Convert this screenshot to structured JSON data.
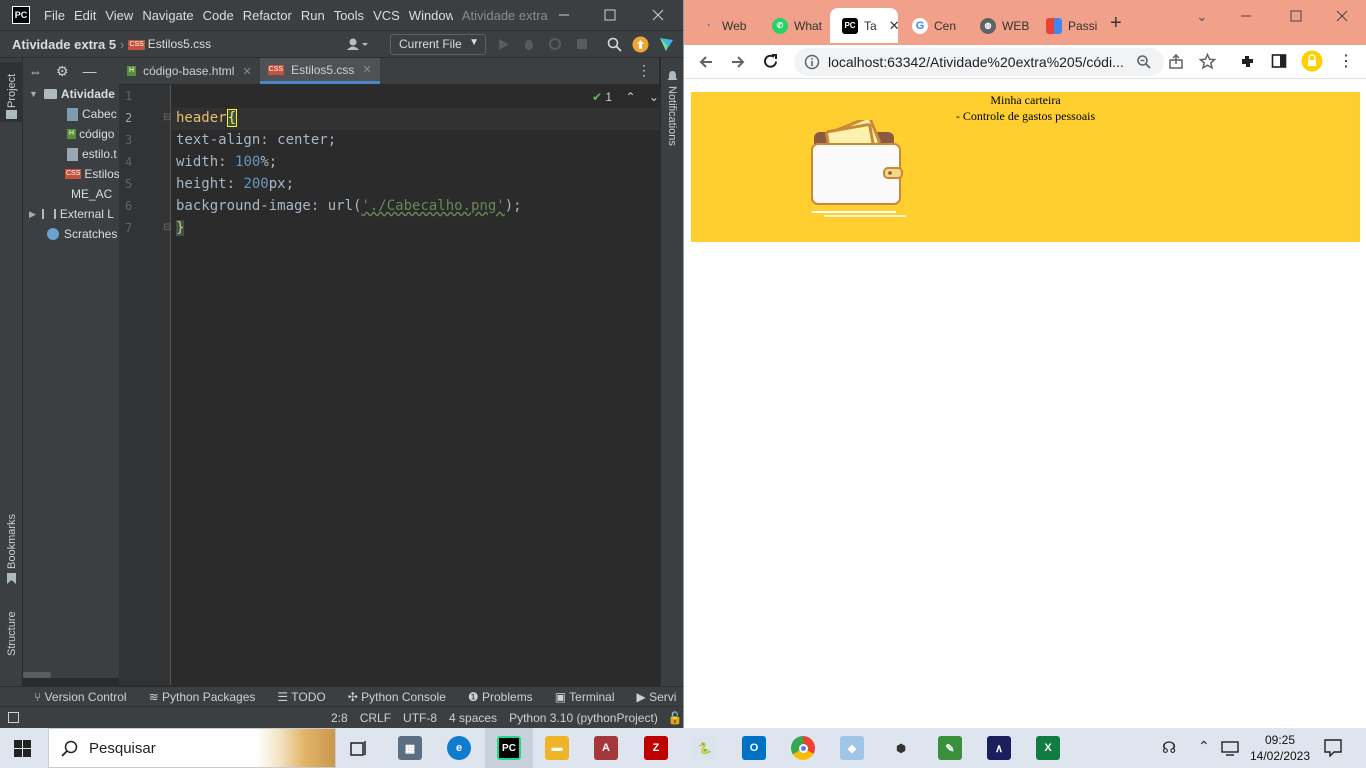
{
  "ide": {
    "logo": "PC",
    "menu": [
      "File",
      "Edit",
      "View",
      "Navigate",
      "Code",
      "Refactor",
      "Run",
      "Tools",
      "VCS",
      "Window"
    ],
    "window_title": "Atividade extra",
    "breadcrumb": {
      "project": "Atividade extra 5",
      "file": "Estilos5.css"
    },
    "run_config": "Current File",
    "left_strip": {
      "project": "Project",
      "bookmarks": "Bookmarks",
      "structure": "Structure"
    },
    "right_strip": {
      "notifications": "Notifications"
    },
    "tree": [
      {
        "label": "Atividade",
        "kind": "folder"
      },
      {
        "label": "Cabec",
        "kind": "image"
      },
      {
        "label": "código",
        "kind": "html"
      },
      {
        "label": "estilo.t",
        "kind": "text"
      },
      {
        "label": "Estilos",
        "kind": "css"
      },
      {
        "label": "ME_AC",
        "kind": "markdown"
      },
      {
        "label": "External L",
        "kind": "library"
      },
      {
        "label": "Scratches",
        "kind": "scratch"
      }
    ],
    "tabs": [
      {
        "label": "código-base.html",
        "badge": "H"
      },
      {
        "label": "Estilos5.css",
        "badge": "CSS"
      }
    ],
    "inspection_count": "1",
    "lines": [
      "1",
      "2",
      "3",
      "4",
      "5",
      "6",
      "7"
    ],
    "code": {
      "l2_selector": "header",
      "l2_brace": "{",
      "l3": "text-align: center;",
      "l4_prop": "width: ",
      "l4_num": "100",
      "l4_unit": "%;",
      "l5_prop": "height: ",
      "l5_num": "200",
      "l5_unit": "px;",
      "l6_prop": "background-image: url(",
      "l6_str": "'./Cabecalho.png'",
      "l6_end": ");",
      "l7": "}"
    },
    "tool_windows": [
      "Version Control",
      "Python Packages",
      "TODO",
      "Python Console",
      "Problems",
      "Terminal",
      "Servi"
    ],
    "status": [
      "2:8",
      "CRLF",
      "UTF-8",
      "4 spaces",
      "Python 3.10 (pythonProject)"
    ]
  },
  "browser": {
    "tabs": [
      "Web",
      "What",
      "Ta",
      "Cen",
      "WEB",
      "Passi"
    ],
    "url": "localhost:63342/Atividade%20extra%205/códi...",
    "page": {
      "title": "Minha carteira",
      "subtitle": "- Controle de gastos pessoais"
    },
    "colors": {
      "header_bg": "#ffcf2f",
      "tabstrip_bg": "#f1a18a"
    }
  },
  "taskbar": {
    "search_placeholder": "Pesquisar",
    "time": "09:25",
    "date": "14/02/2023"
  }
}
